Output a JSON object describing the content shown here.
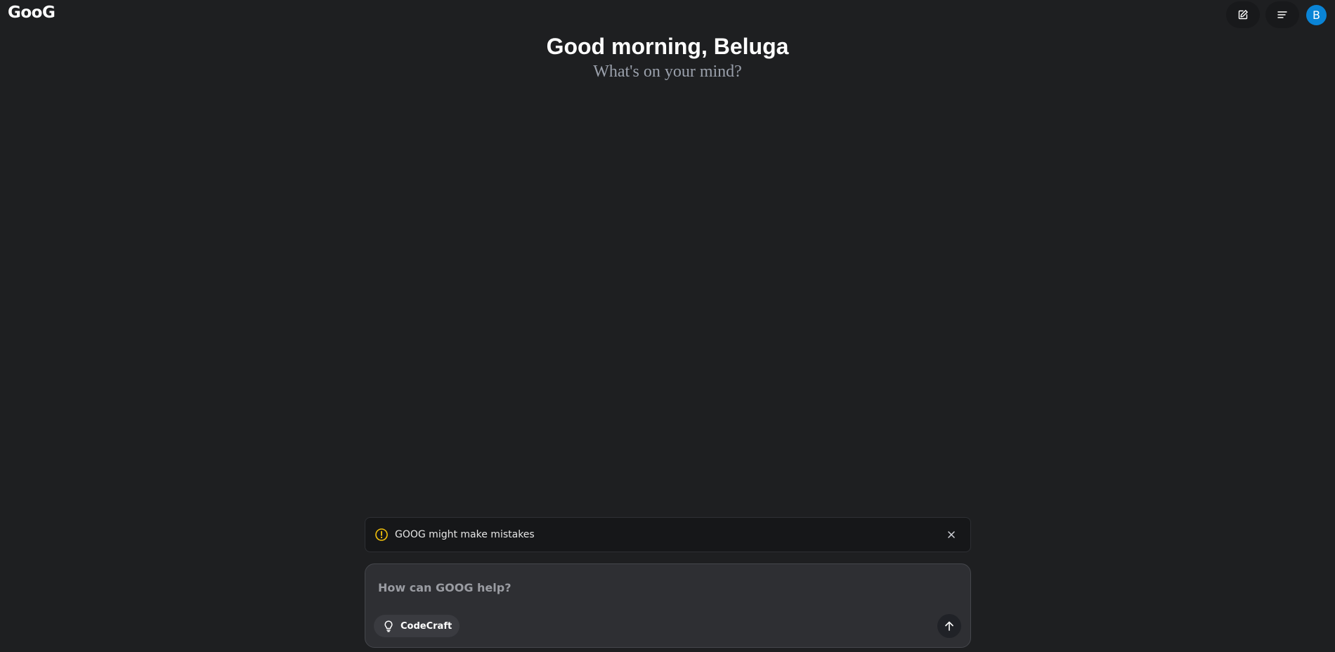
{
  "app": {
    "logo_text": "GooG"
  },
  "header": {
    "actions": [
      {
        "name": "new-chat",
        "icon": "edit-icon"
      },
      {
        "name": "menu",
        "icon": "menu-icon"
      }
    ],
    "avatar_letter": "B",
    "avatar_color": "#0a84d6"
  },
  "hero": {
    "greeting": "Good morning, Beluga",
    "subtitle": "What's on your mind?"
  },
  "notice": {
    "text": "GOOG might make mistakes",
    "icon": "warning-circle-icon",
    "icon_color": "#f2c10b"
  },
  "composer": {
    "placeholder": "How can GOOG help?",
    "value": "",
    "chip_label": "CodeCraft",
    "chip_icon": "lightbulb-icon",
    "send_icon": "arrow-up-icon"
  }
}
